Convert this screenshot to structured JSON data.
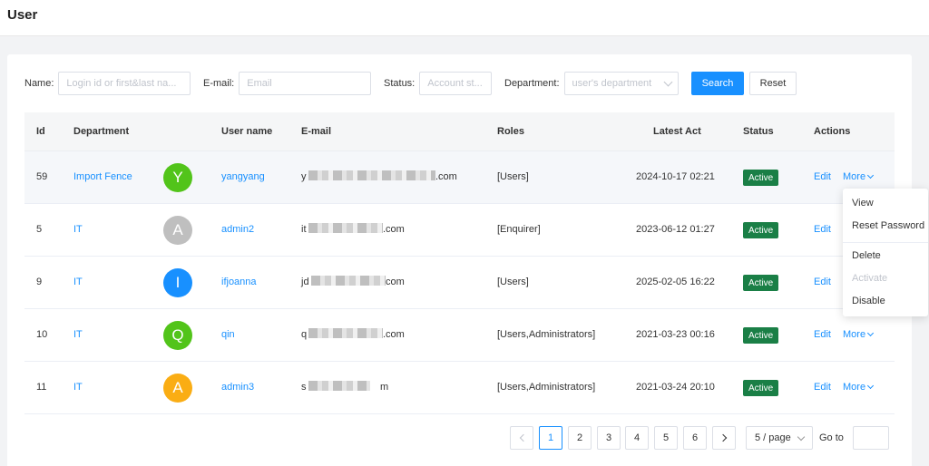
{
  "page": {
    "title": "User"
  },
  "filters": {
    "name_label": "Name:",
    "name_placeholder": "Login id or first&last na...",
    "email_label": "E-mail:",
    "email_placeholder": "Email",
    "status_label": "Status:",
    "status_placeholder": "Account st...",
    "department_label": "Department:",
    "department_placeholder": "user's department",
    "search_label": "Search",
    "reset_label": "Reset"
  },
  "table": {
    "columns": [
      "Id",
      "Department",
      "User name",
      "E-mail",
      "Roles",
      "Latest Act",
      "Status",
      "Actions"
    ],
    "rows": [
      {
        "id": "59",
        "department": "Import Fence",
        "avatar": "Y",
        "avatar_color": "#52c41a",
        "username": "yangyang",
        "email_prefix": "y",
        "email_suffix": ".com",
        "roles": "[Users]",
        "latest": "2024-10-17 02:21",
        "status": "Active",
        "edit": "Edit",
        "more": "More"
      },
      {
        "id": "5",
        "department": "IT",
        "avatar": "A",
        "avatar_color": "#bfbfbf",
        "username": "admin2",
        "email_prefix": "it",
        "email_suffix": ".com",
        "roles": "[Enquirer]",
        "latest": "2023-06-12 01:27",
        "status": "Active",
        "edit": "Edit",
        "more": ""
      },
      {
        "id": "9",
        "department": "IT",
        "avatar": "I",
        "avatar_color": "#1890ff",
        "username": "ifjoanna",
        "email_prefix": "jd",
        "email_suffix": "com",
        "roles": "[Users]",
        "latest": "2025-02-05 16:22",
        "status": "Active",
        "edit": "Edit",
        "more": ""
      },
      {
        "id": "10",
        "department": "IT",
        "avatar": "Q",
        "avatar_color": "#52c41a",
        "username": "qin",
        "email_prefix": "q",
        "email_suffix": ".com",
        "roles": "[Users,Administrators]",
        "latest": "2021-03-23 00:16",
        "status": "Active",
        "edit": "Edit",
        "more": "More"
      },
      {
        "id": "11",
        "department": "IT",
        "avatar": "A",
        "avatar_color": "#faad14",
        "username": "admin3",
        "email_prefix": "s",
        "email_suffix": "m",
        "roles": "[Users,Administrators]",
        "latest": "2021-03-24 20:10",
        "status": "Active",
        "edit": "Edit",
        "more": "More"
      }
    ]
  },
  "more_menu": {
    "view": "View",
    "reset_password": "Reset Password",
    "delete": "Delete",
    "activate": "Activate",
    "disable": "Disable"
  },
  "pagination": {
    "pages": [
      "1",
      "2",
      "3",
      "4",
      "5",
      "6"
    ],
    "current": "1",
    "page_size": "5 / page",
    "goto_label": "Go to",
    "goto_value": ""
  },
  "colors": {
    "accent": "#1890ff",
    "active_badge": "#1a7f46"
  }
}
